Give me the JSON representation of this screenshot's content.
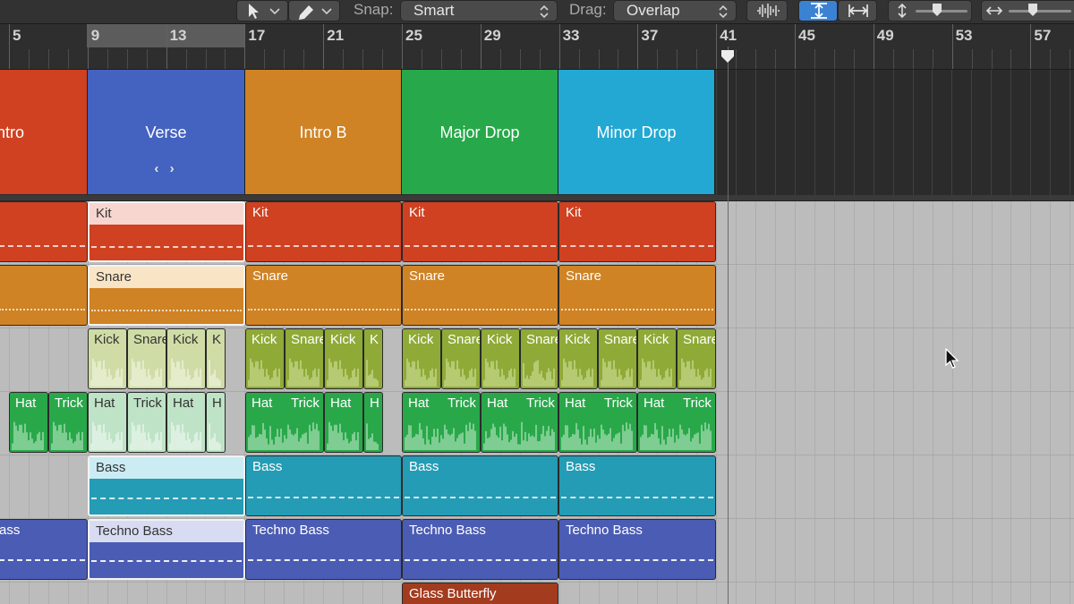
{
  "toolbar": {
    "pointer_tool_icon": "arrow-cursor-icon",
    "pencil_tool_icon": "pencil-tool-icon",
    "snap_label": "Snap:",
    "snap_value": "Smart",
    "drag_label": "Drag:",
    "drag_value": "Overlap",
    "waveform_zoom_icon": "waveform-zoom-icon",
    "vertical_zoom_fit_icon": "vertical-fit-icon",
    "horizontal_zoom_fit_icon": "horizontal-fit-icon",
    "vertical_zoom_icon": "vertical-zoom-icon",
    "horizontal_zoom_icon": "horizontal-zoom-icon"
  },
  "ruler": {
    "bars": [
      "5",
      "9",
      "13",
      "17",
      "21",
      "25",
      "29",
      "33",
      "37",
      "41",
      "45",
      "49",
      "53",
      "57"
    ]
  },
  "arrangement": {
    "markers": [
      {
        "name": "ntro",
        "color": "#cf4121"
      },
      {
        "name": "Verse",
        "color": "#4463c0",
        "nav": "‹ ›"
      },
      {
        "name": "Intro B",
        "color": "#cf8325"
      },
      {
        "name": "Major Drop",
        "color": "#27a84a"
      },
      {
        "name": "Minor Drop",
        "color": "#22a8d2"
      }
    ]
  },
  "tracks": {
    "kit": [
      "Kit",
      "Kit",
      "Kit",
      "Kit"
    ],
    "snare": [
      "Snare",
      "Snare",
      "Snare",
      "Snare"
    ],
    "kick": [
      "Kick",
      "Snare",
      "Kick",
      "K",
      "Kick",
      "Snare",
      "Kick",
      "K",
      "Kick",
      "Snare",
      "Kick",
      "Snare",
      "Kick",
      "Snare",
      "Kick",
      "Snare"
    ],
    "hat": [
      "Hat",
      "Trick",
      "Hat",
      "Trick",
      "Hat",
      "H",
      "Hat",
      "Trick",
      "Hat",
      "H",
      "Hat",
      "Trick",
      "Hat",
      "Trick",
      "Hat",
      "Trick",
      "Hat",
      "Trick"
    ],
    "bass": [
      "Bass",
      "Bass",
      "Bass",
      "Bass"
    ],
    "techno_bass": [
      "ass",
      "Techno Bass",
      "Techno Bass",
      "Techno Bass",
      "Techno Bass"
    ],
    "glass": [
      "Glass Butterfly"
    ]
  }
}
